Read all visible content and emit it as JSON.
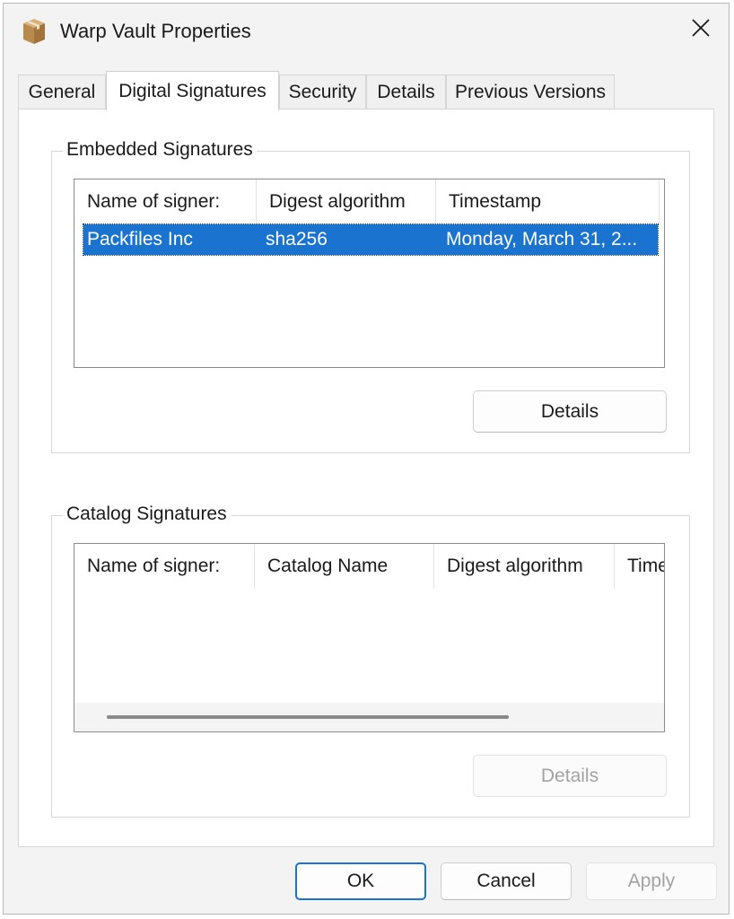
{
  "window": {
    "title": "Warp Vault Properties",
    "icon": "package-box-icon"
  },
  "tabs": [
    {
      "label": "General",
      "active": false
    },
    {
      "label": "Digital Signatures",
      "active": true
    },
    {
      "label": "Security",
      "active": false
    },
    {
      "label": "Details",
      "active": false
    },
    {
      "label": "Previous Versions",
      "active": false
    }
  ],
  "embedded": {
    "group_label": "Embedded Signatures",
    "columns": [
      "Name of signer:",
      "Digest algorithm",
      "Timestamp"
    ],
    "rows": [
      {
        "signer": "Packfiles Inc",
        "digest": "sha256",
        "timestamp": "Monday, March 31, 2...",
        "selected": true
      }
    ],
    "details_button": "Details"
  },
  "catalog": {
    "group_label": "Catalog Signatures",
    "columns": [
      "Name of signer:",
      "Catalog Name",
      "Digest algorithm",
      "Time"
    ],
    "rows": [],
    "details_button": "Details",
    "details_disabled": true
  },
  "footer": {
    "ok": "OK",
    "cancel": "Cancel",
    "apply": "Apply",
    "apply_disabled": true
  },
  "colors": {
    "accent": "#1a73cf",
    "selection": "#1a73cf",
    "window_bg": "#f3f3f3"
  }
}
